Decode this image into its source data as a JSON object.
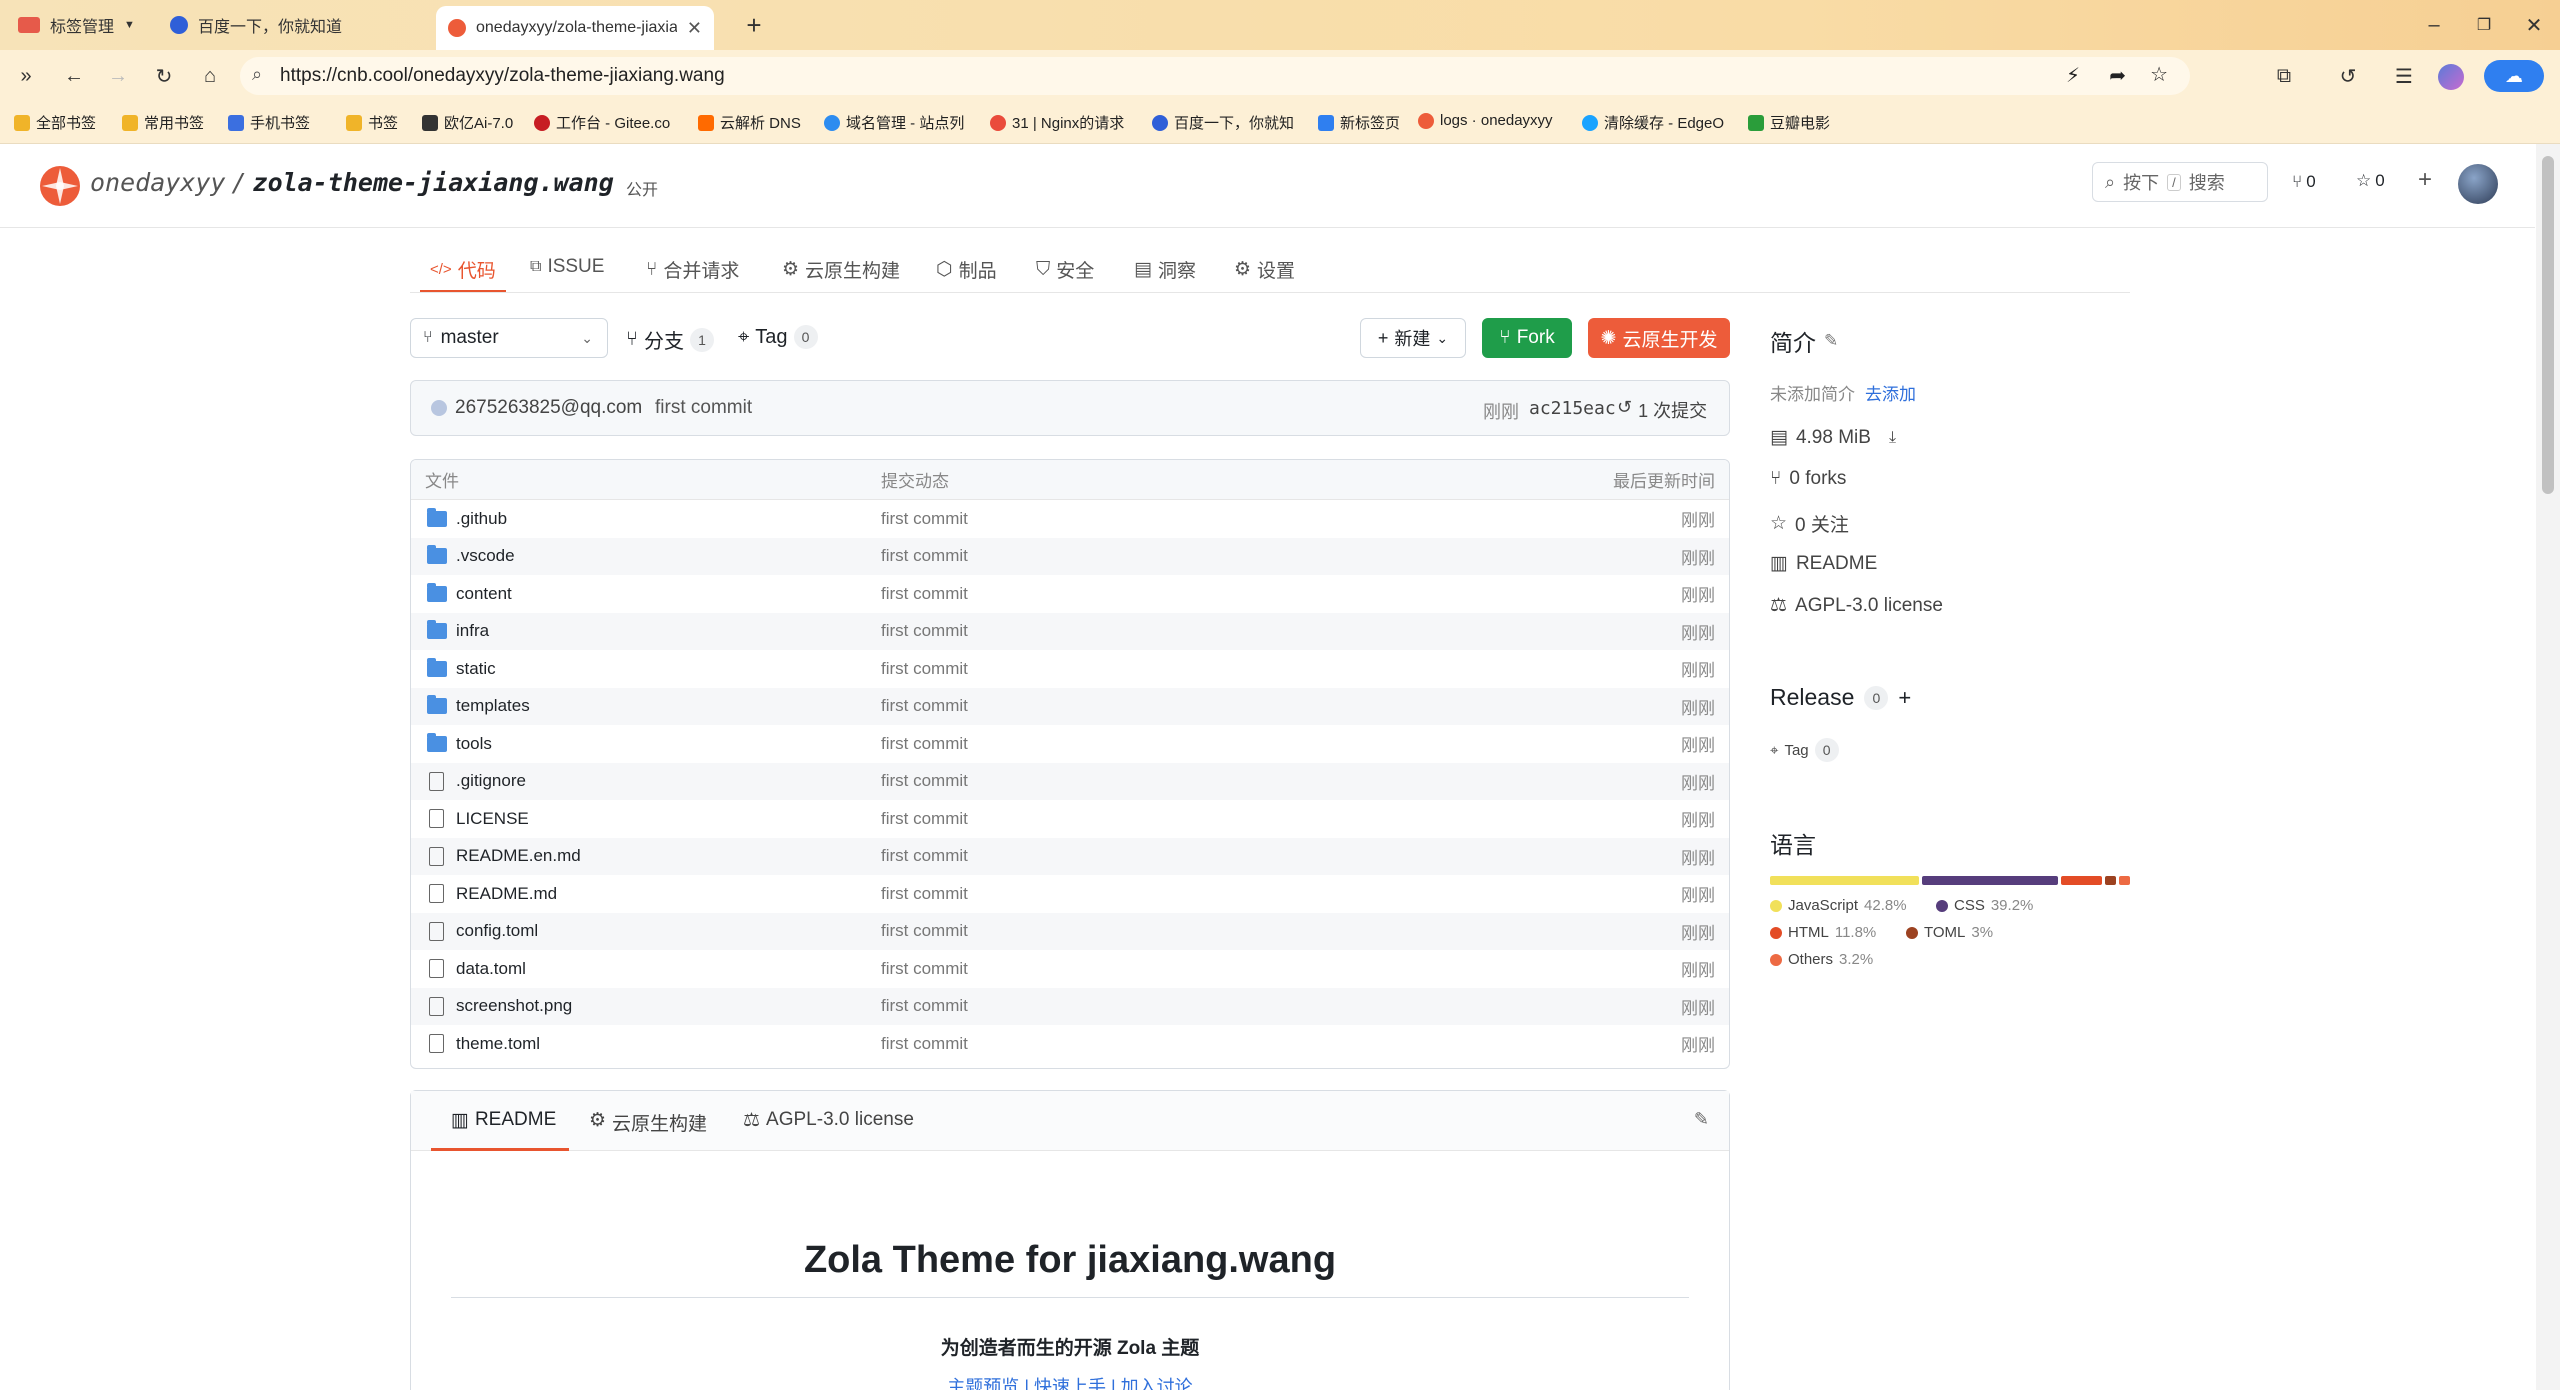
{
  "browser": {
    "tabs": [
      {
        "label": "标签管理"
      },
      {
        "label": "百度一下，你就知道"
      },
      {
        "label": "onedayxyy/zola-theme-jiaxia"
      }
    ],
    "url": "https://cnb.cool/onedayxyy/zola-theme-jiaxiang.wang",
    "bookmarks": [
      "全部书签",
      "常用书签",
      "手机书签",
      "书签",
      "欧亿Ai-7.0",
      "工作台 - Gitee.co",
      "云解析 DNS",
      "域名管理 - 站点列",
      "31 | Nginx的请求",
      "百度一下，你就知",
      "新标签页",
      "logs · onedayxyy",
      "清除缓存 - EdgeO",
      "豆瓣电影"
    ]
  },
  "repo": {
    "owner": "onedayxyy",
    "separator": "/",
    "name": "zola-theme-jiaxiang.wang",
    "visibility": "公开",
    "search_label": "按下",
    "search_key": "/",
    "search_text": "搜索",
    "fork_count": "0",
    "star_count": "0"
  },
  "nav": {
    "tabs": [
      "代码",
      "ISSUE",
      "合并请求",
      "云原生构建",
      "制品",
      "安全",
      "洞察",
      "设置"
    ]
  },
  "toolbar": {
    "branch": "master",
    "branches_label": "分支",
    "branches_count": "1",
    "tags_label": "Tag",
    "tags_count": "0",
    "new_label": "新建",
    "fork_label": "Fork",
    "cloud_dev_label": "云原生开发"
  },
  "commit": {
    "author": "2675263825@qq.com",
    "message": "first commit",
    "time": "刚刚",
    "hash": "ac215eac",
    "count_label": "1 次提交"
  },
  "files": {
    "headers": {
      "name": "文件",
      "message": "提交动态",
      "time": "最后更新时间"
    },
    "rows": [
      {
        "name": ".github",
        "type": "folder",
        "message": "first commit",
        "time": "刚刚"
      },
      {
        "name": ".vscode",
        "type": "folder",
        "message": "first commit",
        "time": "刚刚"
      },
      {
        "name": "content",
        "type": "folder",
        "message": "first commit",
        "time": "刚刚"
      },
      {
        "name": "infra",
        "type": "folder",
        "message": "first commit",
        "time": "刚刚"
      },
      {
        "name": "static",
        "type": "folder",
        "message": "first commit",
        "time": "刚刚"
      },
      {
        "name": "templates",
        "type": "folder",
        "message": "first commit",
        "time": "刚刚"
      },
      {
        "name": "tools",
        "type": "folder",
        "message": "first commit",
        "time": "刚刚"
      },
      {
        "name": ".gitignore",
        "type": "file",
        "message": "first commit",
        "time": "刚刚"
      },
      {
        "name": "LICENSE",
        "type": "file",
        "message": "first commit",
        "time": "刚刚"
      },
      {
        "name": "README.en.md",
        "type": "file",
        "message": "first commit",
        "time": "刚刚"
      },
      {
        "name": "README.md",
        "type": "file",
        "message": "first commit",
        "time": "刚刚"
      },
      {
        "name": "config.toml",
        "type": "file",
        "message": "first commit",
        "time": "刚刚"
      },
      {
        "name": "data.toml",
        "type": "file",
        "message": "first commit",
        "time": "刚刚"
      },
      {
        "name": "screenshot.png",
        "type": "file",
        "message": "first commit",
        "time": "刚刚"
      },
      {
        "name": "theme.toml",
        "type": "file",
        "message": "first commit",
        "time": "刚刚"
      }
    ]
  },
  "sidebar": {
    "intro_title": "简介",
    "intro_empty": "未添加简介",
    "intro_add": "去添加",
    "size": "4.98 MiB",
    "forks": "0 forks",
    "watch": "0 关注",
    "readme": "README",
    "license": "AGPL-3.0 license",
    "release_title": "Release",
    "release_count": "0",
    "tag_label": "Tag",
    "tag_count": "0",
    "lang_title": "语言",
    "languages": [
      {
        "name": "JavaScript",
        "percent": "42.8%",
        "value": 42.8,
        "color": "#f1e05a"
      },
      {
        "name": "CSS",
        "percent": "39.2%",
        "value": 39.2,
        "color": "#563d7c"
      },
      {
        "name": "HTML",
        "percent": "11.8%",
        "value": 11.8,
        "color": "#e34c26"
      },
      {
        "name": "TOML",
        "percent": "3%",
        "value": 3,
        "color": "#9c4221"
      },
      {
        "name": "Others",
        "percent": "3.2%",
        "value": 3.2,
        "color": "#ed6a43"
      }
    ]
  },
  "readme": {
    "tabs": [
      "README",
      "云原生构建",
      "AGPL-3.0 license"
    ],
    "heading": "Zola Theme for jiaxiang.wang",
    "subtitle": "为创造者而生的开源 Zola 主题",
    "links": "主题预览 | 快速上手 | 加入讨论"
  }
}
